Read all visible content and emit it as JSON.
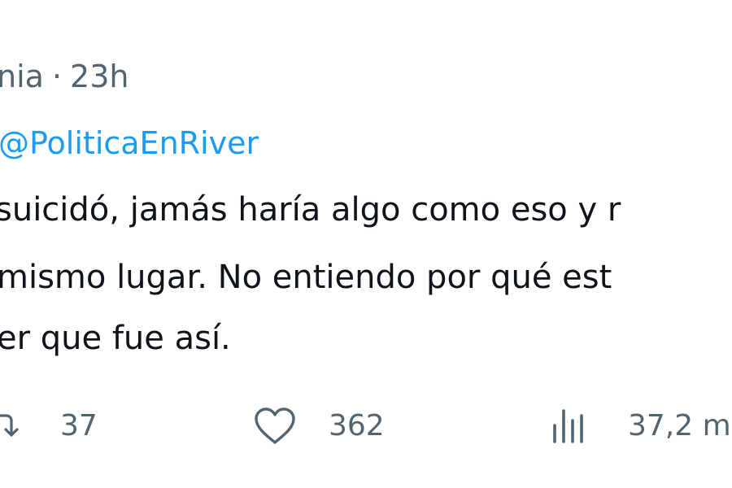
{
  "tweet": {
    "author_partial": "nia",
    "separator": "·",
    "time": "23h",
    "replying_to": "@PoliticaEnRiver",
    "lines": [
      "suicidó, jamás haría algo como eso y r",
      "mismo lugar. No entiendo por qué est",
      "er que fue así."
    ]
  },
  "actions": {
    "retweet_count": "37",
    "like_count": "362",
    "views_count": "37,2 m"
  },
  "icons": {
    "retweet": "retweet-icon",
    "like": "heart-icon",
    "views": "views-bar-chart-icon"
  },
  "colors": {
    "text": "#0f1419",
    "secondary": "#536471",
    "link": "#1d9bf0",
    "background": "#ffffff"
  }
}
